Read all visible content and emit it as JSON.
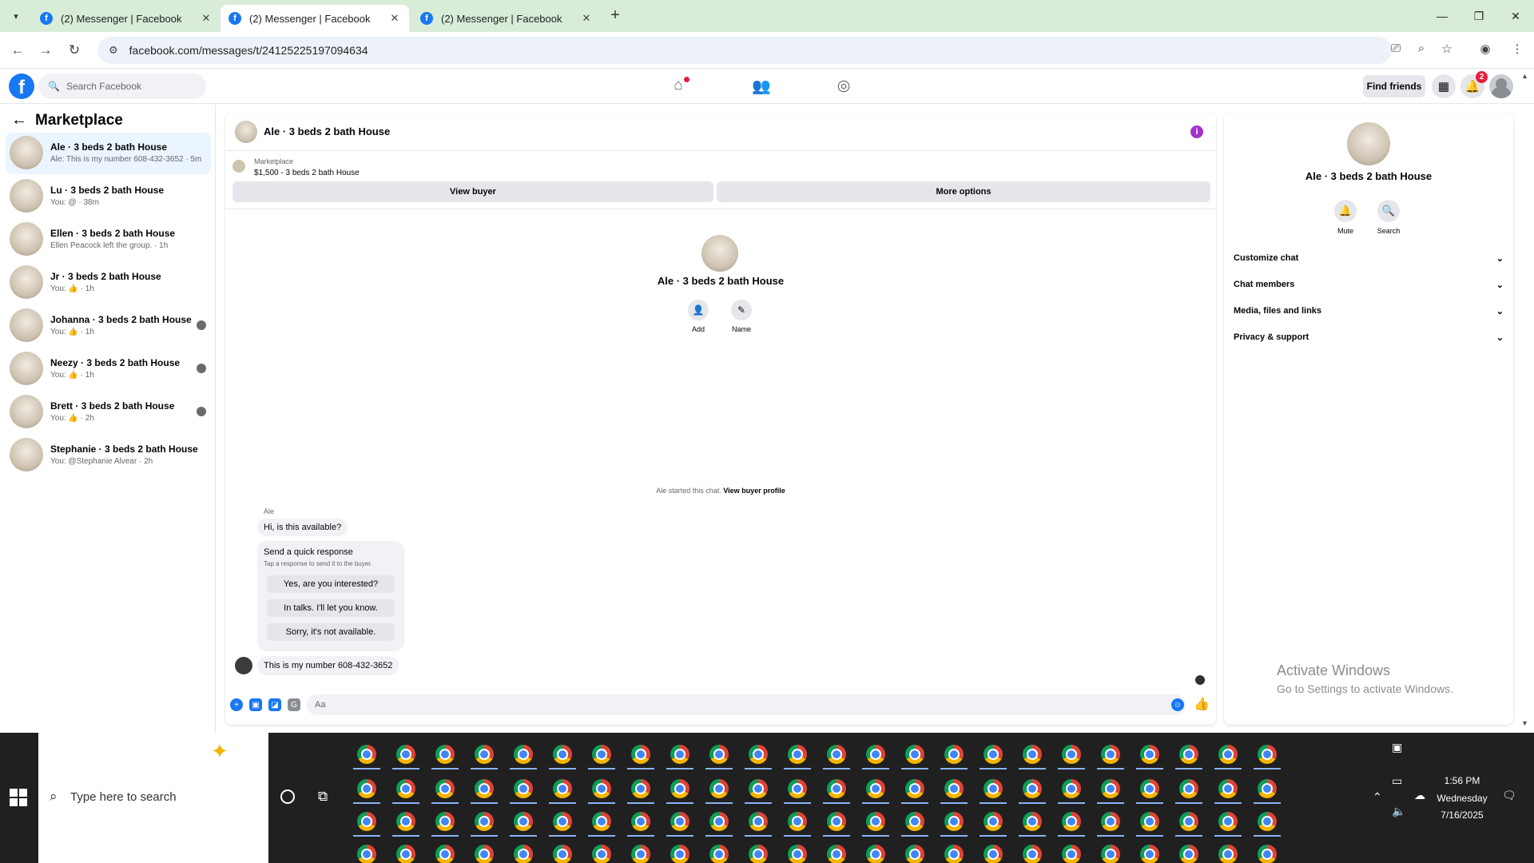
{
  "browser": {
    "tabs": [
      {
        "title": "(2) Messenger | Facebook",
        "active": false
      },
      {
        "title": "(2) Messenger | Facebook",
        "active": true
      },
      {
        "title": "(2) Messenger | Facebook",
        "active": false
      }
    ],
    "url": "facebook.com/messages/t/24125225197094634"
  },
  "fb_header": {
    "search_placeholder": "Search Facebook",
    "find_friends": "Find friends",
    "notification_count": "2"
  },
  "sidebar": {
    "title": "Marketplace",
    "conversations": [
      {
        "name": "Ale · 3 beds 2 bath House",
        "preview": "Ale: This is my number 608-432-3652 · 5m",
        "active": true
      },
      {
        "name": "Lu · 3 beds 2 bath House",
        "preview": "You: @ · 38m",
        "active": false
      },
      {
        "name": "Ellen · 3 beds 2 bath House",
        "preview": "Ellen Peacock left the group. · 1h",
        "active": false
      },
      {
        "name": "Jr · 3 beds 2 bath House",
        "preview": "You: 👍 · 1h",
        "active": false
      },
      {
        "name": "Johanna · 3 beds 2 bath House",
        "preview": "You: 👍 · 1h",
        "active": false
      },
      {
        "name": "Neezy · 3 beds 2 bath House",
        "preview": "You: 👍 · 1h",
        "active": false
      },
      {
        "name": "Brett · 3 beds 2 bath House",
        "preview": "You: 👍 · 2h",
        "active": false
      },
      {
        "name": "Stephanie · 3 beds 2 bath House",
        "preview": "You: @Stephanie Alvear · 2h",
        "active": false
      }
    ]
  },
  "chat": {
    "title": "Ale · 3 beds 2 bath House",
    "listing_label": "Marketplace",
    "listing_price": "$1,500 - 3 beds 2 bath House",
    "view_buyer": "View buyer",
    "more_options": "More options",
    "center_name": "Ale · 3 beds 2 bath House",
    "actions": [
      {
        "label": "Add"
      },
      {
        "label": "Name"
      }
    ],
    "started_text": "Ale started this chat.",
    "view_buyer_profile": "View buyer profile",
    "sender": "Ale",
    "first_message": "Hi, is this available?",
    "quick_response": {
      "title": "Send a quick response",
      "subtitle": "Tap a response to send it to the buyer.",
      "options": [
        "Yes, are you interested?",
        "In talks. I'll let you know.",
        "Sorry, it's not available."
      ]
    },
    "last_message": "This is my number  608-432-3652",
    "composer_placeholder": "Aa"
  },
  "right_panel": {
    "name": "Ale · 3 beds 2 bath House",
    "actions": [
      {
        "label": "Mute"
      },
      {
        "label": "Search"
      }
    ],
    "sections": [
      "Customize chat",
      "Chat members",
      "Media, files and links",
      "Privacy & support"
    ],
    "watermark_title": "Activate Windows",
    "watermark_sub": "Go to Settings to activate Windows."
  },
  "taskbar": {
    "search_placeholder": "Type here to search",
    "time": "1:56 PM",
    "day": "Wednesday",
    "date": "7/16/2025"
  },
  "colors": {
    "fb_blue": "#1877f2",
    "tabbar_bg": "#d8ecd8",
    "active_conv_bg": "#ebf5ff",
    "info_purple": "#a333c8"
  }
}
